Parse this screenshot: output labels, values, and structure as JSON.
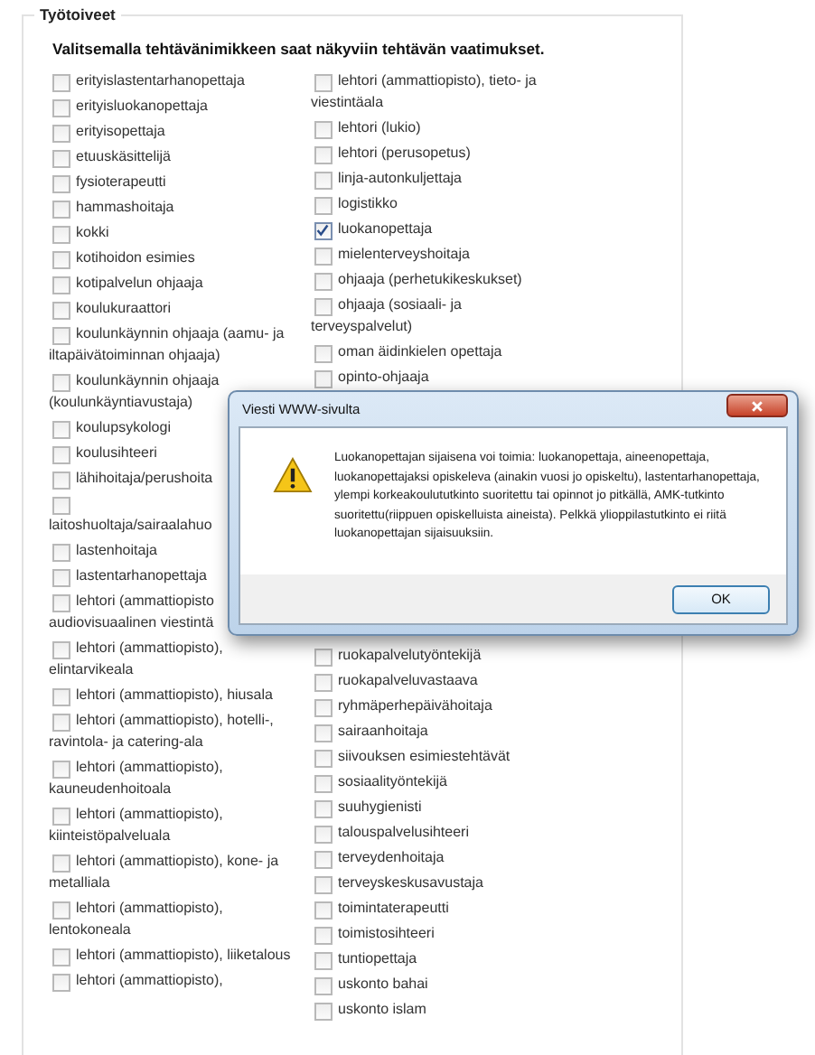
{
  "section": {
    "legend": "Työtoiveet",
    "heading": "Valitsemalla tehtävänimikkeen saat näkyviin tehtävän vaatimukset."
  },
  "left_options": [
    {
      "text": "erityislastentarhanopettaja",
      "checked": false
    },
    {
      "text": "erityisluokanopettaja",
      "checked": false
    },
    {
      "text": "erityisopettaja",
      "checked": false
    },
    {
      "text": "etuuskäsittelijä",
      "checked": false
    },
    {
      "text": "fysioterapeutti",
      "checked": false
    },
    {
      "text": "hammashoitaja",
      "checked": false
    },
    {
      "text": "kokki",
      "checked": false
    },
    {
      "text": "kotihoidon esimies",
      "checked": false
    },
    {
      "text": "kotipalvelun ohjaaja",
      "checked": false
    },
    {
      "text": "koulukuraattori",
      "checked": false
    },
    {
      "text": "koulunkäynnin ohjaaja (aamu- ja iltapäivätoiminnan ohjaaja)",
      "checked": false
    },
    {
      "text": "koulunkäynnin ohjaaja (koulunkäyntiavustaja)",
      "checked": false
    },
    {
      "text": "koulupsykologi",
      "checked": false
    },
    {
      "text": "koulusihteeri",
      "checked": false
    },
    {
      "text": "lähihoitaja/perushoita",
      "checked": false
    },
    {
      "text": "laitoshuoltaja/sairaalahuo",
      "checked": false,
      "break": true
    },
    {
      "text": "lastenhoitaja",
      "checked": false
    },
    {
      "text": "lastentarhanopettaja",
      "checked": false
    },
    {
      "text": "lehtori (ammattiopisto\naudiovisuaalinen viestintä",
      "checked": false
    },
    {
      "text": "lehtori (ammattiopisto), elintarvikeala",
      "checked": false
    },
    {
      "text": "lehtori (ammattiopisto), hiusala",
      "checked": false
    },
    {
      "text": "lehtori (ammattiopisto), hotelli-, ravintola- ja catering-ala",
      "checked": false
    },
    {
      "text": "lehtori (ammattiopisto), kauneudenhoitoala",
      "checked": false
    },
    {
      "text": "lehtori (ammattiopisto), kiinteistöpalveluala",
      "checked": false
    },
    {
      "text": "lehtori (ammattiopisto), kone- ja metalliala",
      "checked": false
    },
    {
      "text": "lehtori (ammattiopisto), lentokoneala",
      "checked": false
    },
    {
      "text": "lehtori (ammattiopisto), liiketalous",
      "checked": false
    },
    {
      "text": "lehtori (ammattiopisto),",
      "checked": false
    }
  ],
  "right_options_top": [
    {
      "text": "lehtori (ammattiopisto), tieto- ja viestintäala",
      "checked": false
    },
    {
      "text": "lehtori (lukio)",
      "checked": false
    },
    {
      "text": "lehtori (perusopetus)",
      "checked": false
    },
    {
      "text": "linja-autonkuljettaja",
      "checked": false
    },
    {
      "text": "logistikko",
      "checked": false
    },
    {
      "text": "luokanopettaja",
      "checked": true
    },
    {
      "text": "mielenterveyshoitaja",
      "checked": false
    },
    {
      "text": "ohjaaja (perhetukikeskukset)",
      "checked": false
    },
    {
      "text": "ohjaaja (sosiaali- ja terveyspalvelut)",
      "checked": false
    },
    {
      "text": "oman äidinkielen opettaja",
      "checked": false
    },
    {
      "text": "opinto-ohjaaja",
      "checked": false
    }
  ],
  "right_options_bottom": [
    {
      "text": "ruokapalvelutyöntekijä",
      "checked": false
    },
    {
      "text": "ruokapalveluvastaava",
      "checked": false
    },
    {
      "text": "ryhmäperhepäivähoitaja",
      "checked": false
    },
    {
      "text": "sairaanhoitaja",
      "checked": false
    },
    {
      "text": "siivouksen esimiestehtävät",
      "checked": false
    },
    {
      "text": "sosiaalityöntekijä",
      "checked": false
    },
    {
      "text": "suuhygienisti",
      "checked": false
    },
    {
      "text": "talouspalvelusihteeri",
      "checked": false
    },
    {
      "text": "terveydenhoitaja",
      "checked": false
    },
    {
      "text": "terveyskeskusavustaja",
      "checked": false
    },
    {
      "text": "toimintaterapeutti",
      "checked": false
    },
    {
      "text": "toimistosihteeri",
      "checked": false
    },
    {
      "text": "tuntiopettaja",
      "checked": false
    },
    {
      "text": "uskonto bahai",
      "checked": false
    },
    {
      "text": "uskonto islam",
      "checked": false
    }
  ],
  "dialog": {
    "title": "Viesti WWW-sivulta",
    "message": "Luokanopettajan sijaisena voi toimia: luokanopettaja, aineenopettaja, luokanopettajaksi opiskeleva (ainakin vuosi jo opiskeltu), lastentarhanopettaja, ylempi korkeakoulututkinto suoritettu tai opinnot jo pitkällä, AMK-tutkinto suoritettu(riippuen opiskelluista aineista). Pelkkä ylioppilastutkinto ei riitä luokanopettajan sijaisuuksiin.",
    "button": "OK"
  }
}
